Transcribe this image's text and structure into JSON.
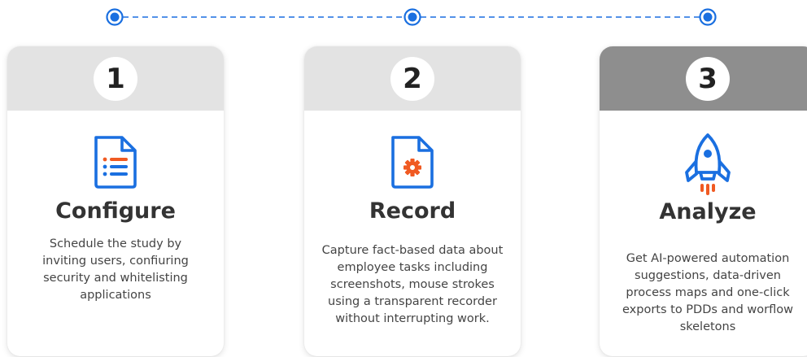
{
  "colors": {
    "accent_blue": "#1a6fe0",
    "accent_orange": "#f05a22",
    "header_light": "#e3e3e3",
    "header_dark": "#8e8e8e"
  },
  "timeline": {
    "node_count": 3,
    "connector_style": "dashed"
  },
  "cards": [
    {
      "number": "1",
      "icon": "list-document-icon",
      "title": "Configure",
      "description_lines": [
        "Schedule the study by",
        "inviting users, confiuring",
        "security and whitelisting",
        "applications"
      ]
    },
    {
      "number": "2",
      "icon": "gear-document-icon",
      "title": "Record",
      "description_lines": [
        "Capture fact-based data about",
        "employee tasks including",
        "screenshots, mouse strokes",
        "using a transparent recorder",
        "without interrupting work."
      ]
    },
    {
      "number": "3",
      "icon": "rocket-icon",
      "title": "Analyze",
      "description_lines": [
        "Get AI-powered automation",
        "suggestions,  data-driven",
        "process maps and one-click",
        "exports to PDDs and worflow",
        "skeletons"
      ]
    }
  ]
}
